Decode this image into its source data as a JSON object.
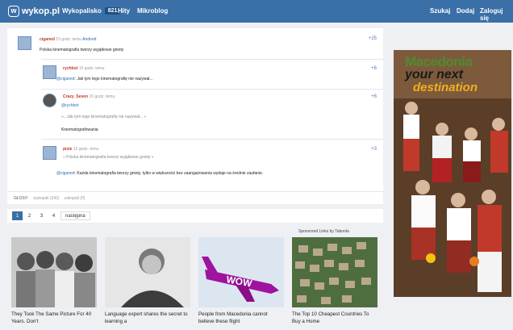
{
  "topbar": {
    "logo": "wykop.pl",
    "nav": [
      {
        "label": "Wykopalisko",
        "badge": "821"
      },
      {
        "label": "Hity"
      },
      {
        "label": "Mikroblog"
      }
    ],
    "right": [
      "Szukaj",
      "Dodaj",
      "Zaloguj się"
    ]
  },
  "comments": [
    {
      "user": "ciganed",
      "time": "15 godz. temu",
      "via": "Android",
      "score": "+25",
      "text": "Polska kinematografia tworzy wyjątkowe gnioty"
    },
    {
      "user": "rychbot",
      "time": "15 godz. temu",
      "via": "",
      "score": "+6",
      "mention": "@ciganed",
      "text": ": Jak tym tego kinematografię nie nazywał..."
    },
    {
      "user": "Crazy_Seven",
      "time": "15 godz. temu",
      "via": "",
      "score": "+6",
      "mention": "@rychbot",
      "quote": "»...Jak tym tego kinematografię nie nazywał... «",
      "text": "Kinematografowania"
    },
    {
      "user": "pixie",
      "time": "15 godz. temu",
      "via": "",
      "score": "+3",
      "quote": "» Polska kinematografia tworzy wyjątkowe gnioty «",
      "mention": "@ciganed",
      "text": ": Każda kinematografia tworzy gnioty, tylko w większości bez zaangażowania wydaje na średnie zaufanie."
    }
  ],
  "votes": {
    "label": "GŁOSY:",
    "up": "wykopali (242)",
    "down": "zakopali (0)"
  },
  "pagination": {
    "pages": [
      "1",
      "2",
      "3",
      "4"
    ],
    "next": "następna"
  },
  "sponsored": "Sponsored Links by Taboola",
  "cards": [
    {
      "caption": "They Took The Same Picture For 40 Years. Don't",
      "colors": [
        "#cfcfcf",
        "#5a5a5a"
      ]
    },
    {
      "caption": "Language expert shares the secret to learning a",
      "colors": [
        "#e4e4e4",
        "#6a6a6a"
      ]
    },
    {
      "caption": "People from Macedonia cannot believe these flight",
      "colors": [
        "#e0eaf4",
        "#a012a0"
      ]
    },
    {
      "caption": "The Top 10 Cheapest Countries To Buy a Home",
      "colors": [
        "#4a6a3a",
        "#b9a68a"
      ]
    }
  ],
  "ad": {
    "line1": "Macedonia",
    "line2": "your next",
    "line3": "destination"
  }
}
